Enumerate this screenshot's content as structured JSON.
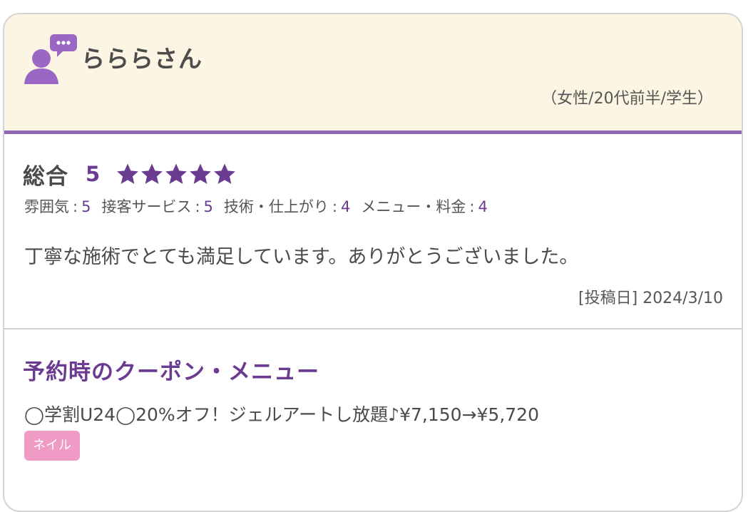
{
  "reviewer": {
    "name": "らららさん",
    "attributes": "（女性/20代前半/学生）",
    "avatar_icon": "user-comment-icon"
  },
  "review": {
    "overall_label": "総合",
    "overall_score": "5",
    "stars": 5,
    "star_color": "#6b3b92",
    "sub_ratings": [
      {
        "label": "雰囲気",
        "value": "5"
      },
      {
        "label": "接客サービス",
        "value": "5"
      },
      {
        "label": "技術・仕上がり",
        "value": "4"
      },
      {
        "label": "メニュー・料金",
        "value": "4"
      }
    ],
    "separator": ":",
    "comment": "丁寧な施術でとても満足しています。ありがとうございました。",
    "post_date": "[投稿日] 2024/3/10"
  },
  "coupon": {
    "title": "予約時のクーポン・メニュー",
    "text": "◯学割U24◯20%オフ！ジェルアートし放題♪¥7,150→¥5,720",
    "tag": "ネイル",
    "tag_color": "#f09bc6"
  },
  "colors": {
    "accent": "#6b3b92",
    "header_bg": "#fdf5e3",
    "divider": "#9065b4"
  }
}
